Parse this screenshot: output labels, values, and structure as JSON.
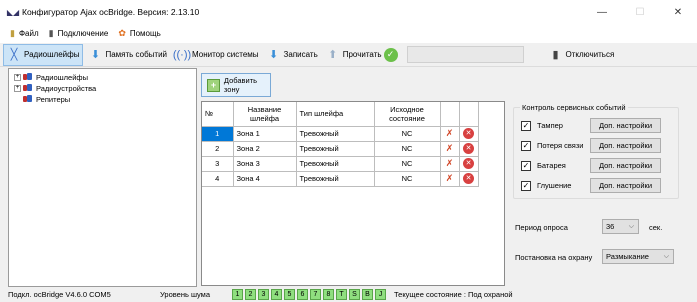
{
  "window": {
    "title": "Конфигуратор Ajax ocBridge. Версия: 2.13.10",
    "minimize": "—",
    "maximize": "☐",
    "close": "✕"
  },
  "menu": [
    {
      "label": "Файл",
      "icon": "file-icon"
    },
    {
      "label": "Подключение",
      "icon": "connection-icon"
    },
    {
      "label": "Помощь",
      "icon": "help-icon"
    }
  ],
  "toolbar": {
    "radio_loops": "Радиошлейфы",
    "event_memory": "Память событий",
    "system_monitor": "Монитор системы",
    "write": "Записать",
    "read": "Прочитать",
    "disconnect": "Отключиться"
  },
  "tree": [
    {
      "label": "Радиошлейфы",
      "expander": "+"
    },
    {
      "label": "Радиоустройства",
      "expander": "+"
    },
    {
      "label": "Репитеры",
      "expander": ""
    }
  ],
  "add_zone": "Добавить зону",
  "zones_table": {
    "headers": [
      "№",
      "Название шлейфа",
      "Тип шлейфа",
      "Исходное состояние"
    ],
    "rows": [
      {
        "num": "1",
        "name": "Зона 1",
        "type": "Тревожный",
        "state": "NC"
      },
      {
        "num": "2",
        "name": "Зона 2",
        "type": "Тревожный",
        "state": "NC"
      },
      {
        "num": "3",
        "name": "Зона 3",
        "type": "Тревожный",
        "state": "NC"
      },
      {
        "num": "4",
        "name": "Зона 4",
        "type": "Тревожный",
        "state": "NC"
      }
    ],
    "selected_row": 0
  },
  "service_events": {
    "title": "Контроль сервисных событий",
    "items": [
      {
        "label": "Тампер",
        "checked": true,
        "button": "Доп. настройки"
      },
      {
        "label": "Потеря связи",
        "checked": true,
        "button": "Доп. настройки"
      },
      {
        "label": "Батарея",
        "checked": true,
        "button": "Доп. настройки"
      },
      {
        "label": "Глушение",
        "checked": true,
        "button": "Доп. настройки"
      }
    ]
  },
  "polling": {
    "label": "Период опроса",
    "value": "36",
    "unit": "сек."
  },
  "arming": {
    "label": "Постановка на охрану",
    "value": "Размыкание"
  },
  "status": {
    "device": "Подкл. ocBridge V4.6.0  COM5",
    "noise_label": "Уровень шума",
    "noise_cells": [
      "1",
      "2",
      "3",
      "4",
      "5",
      "6",
      "7",
      "8",
      "T",
      "S",
      "B",
      "J"
    ],
    "state": "Текущее состояние : Под охраной"
  },
  "colors": {
    "selection": "#0078d7",
    "noise_green": "#8fdf7f",
    "active_tab": "#cce4f7"
  }
}
